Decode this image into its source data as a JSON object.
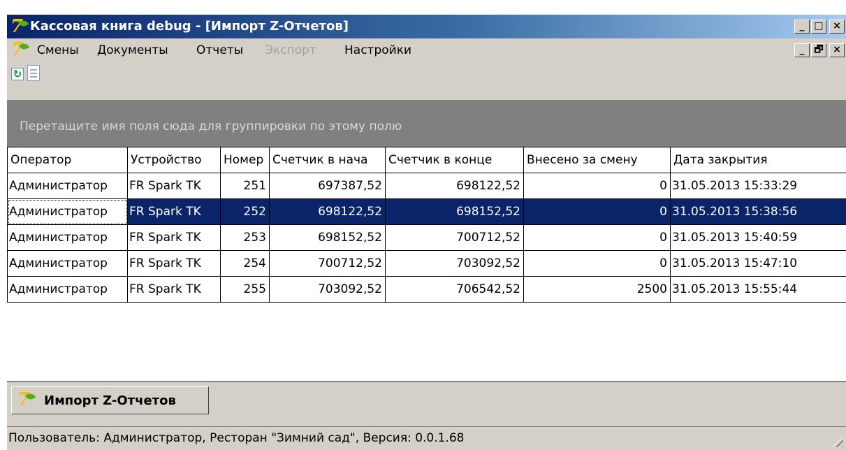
{
  "window": {
    "title": "Кассовая книга debug - [Импорт Z-Отчетов]",
    "app_icon": "app-logo-icon",
    "caption_buttons": {
      "minimize": "_",
      "maximize": "□",
      "close": "×"
    },
    "mdi_buttons": {
      "minimize": "_",
      "restore": "🗗",
      "close": "×"
    }
  },
  "menu": {
    "items": [
      {
        "label": "Смены",
        "enabled": true
      },
      {
        "label": "Документы",
        "enabled": true
      },
      {
        "label": "Отчеты",
        "enabled": true
      },
      {
        "label": "Экспорт",
        "enabled": false
      },
      {
        "label": "Настройки",
        "enabled": true
      }
    ]
  },
  "toolbar": {
    "buttons": [
      "refresh-icon",
      "document-icon"
    ]
  },
  "group_panel": {
    "text": "Перетащите имя поля сюда для группировки по этому полю"
  },
  "grid": {
    "columns": [
      "Оператор",
      "Устройство",
      "Номер",
      "Счетчик в нача",
      "Счетчик в конце",
      "Внесено за смену",
      "Дата закрытия"
    ],
    "rows": [
      [
        "Администратор",
        "FR Spark TK",
        "251",
        "697387,52",
        "698122,52",
        "0",
        "31.05.2013 15:33:29"
      ],
      [
        "Администратор",
        "FR Spark TK",
        "252",
        "698122,52",
        "698152,52",
        "0",
        "31.05.2013 15:38:56"
      ],
      [
        "Администратор",
        "FR Spark TK",
        "253",
        "698152,52",
        "700712,52",
        "0",
        "31.05.2013 15:40:59"
      ],
      [
        "Администратор",
        "FR Spark TK",
        "254",
        "700712,52",
        "703092,52",
        "0",
        "31.05.2013 15:47:10"
      ],
      [
        "Администратор",
        "FR Spark TK",
        "255",
        "703092,52",
        "706542,52",
        "2500",
        "31.05.2013 15:55:44"
      ]
    ],
    "selected_row": 1
  },
  "tabs": [
    {
      "label": "Импорт Z-Отчетов",
      "active": true
    }
  ],
  "status": {
    "text": "Пользователь: Администратор, Ресторан \"Зимний сад\", Версия: 0.0.1.68"
  },
  "colors": {
    "titlebar_start": "#0a246a",
    "titlebar_end": "#a6caf0",
    "selection": "#0a246a",
    "group_panel": "#808080",
    "face": "#d4d0c8"
  }
}
